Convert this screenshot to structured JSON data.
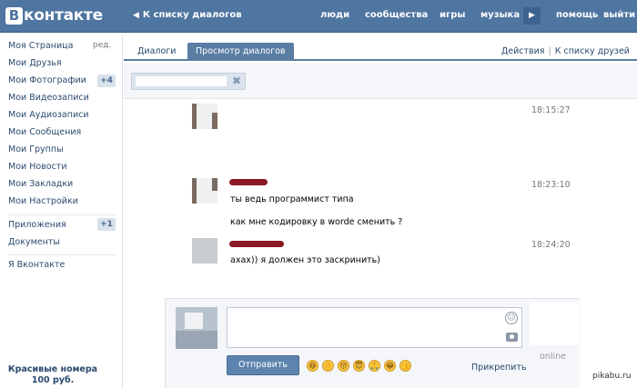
{
  "brand": {
    "logo_letter": "B",
    "logo_text": "контакте"
  },
  "topnav": {
    "back_arrow": "◀",
    "back_label": "К списку диалогов",
    "items": [
      "люди",
      "сообщества",
      "игры",
      "музыка",
      "помощь",
      "выйти"
    ],
    "play_icon": "▶"
  },
  "sidebar": {
    "edit_label": "ред.",
    "items": [
      "Моя Страница",
      "Мои Друзья",
      "Мои Фотографии",
      "Мои Видеозаписи",
      "Мои Аудиозаписи",
      "Мои Сообщения",
      "Мои Группы",
      "Мои Новости",
      "Мои Закладки",
      "Мои Настройки"
    ],
    "photos_badge": "+4",
    "apps_label": "Приложения",
    "apps_badge": "+1",
    "docs_label": "Документы",
    "about_label": "Я Вконтакте",
    "promo_line1": "Красивые номера",
    "promo_line2": "100 руб."
  },
  "tabs": [
    "Диалоги",
    "Просмотр диалогов"
  ],
  "actions": {
    "actions_label": "Действия",
    "separator": "|",
    "back_friends": "К списку друзей"
  },
  "filter": {
    "chip_close": "✖"
  },
  "messages": [
    {
      "time": "18:15:27",
      "lines": []
    },
    {
      "time": "18:23:10",
      "lines": [
        "ты ведь программист типа",
        "как мне кодировку в worde сменить ?"
      ]
    },
    {
      "time": "18:24:20",
      "lines": [
        "ахах)) я должен это заскринить)"
      ]
    }
  ],
  "compose": {
    "smile_icon": "☺",
    "online_label": "online",
    "send_label": "Отправить",
    "attach_label": "Прикрепить",
    "emojis": [
      "😆",
      "👌",
      "😚",
      "😇",
      "🙏",
      "😂",
      "👍"
    ]
  },
  "watermark": "pikabu.ru",
  "colors": {
    "topbar": "#4f75a1",
    "link": "#2b4a6f",
    "badge_bg": "#d9e1ea",
    "name_blot": "#8b1a25"
  }
}
